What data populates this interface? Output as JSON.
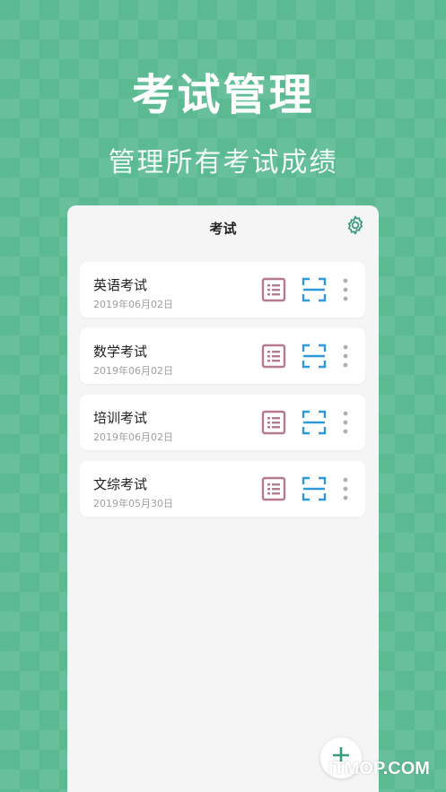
{
  "hero": {
    "title": "考试管理",
    "subtitle": "管理所有考试成绩"
  },
  "app": {
    "title": "考试",
    "settings_icon": "gear-icon",
    "exams": [
      {
        "name": "英语考试",
        "date": "2019年06月02日"
      },
      {
        "name": "数学考试",
        "date": "2019年06月02日"
      },
      {
        "name": "培训考试",
        "date": "2019年06月02日"
      },
      {
        "name": "文综考试",
        "date": "2019年05月30日"
      }
    ],
    "actions": {
      "report_icon": "report-list-icon",
      "scan_icon": "scan-icon",
      "more_icon": "more-vertical-icon"
    },
    "fab_icon": "plus-icon"
  },
  "colors": {
    "background": "#5cba93",
    "accent_green": "#3a9b7a",
    "report_icon": "#b57a8c",
    "scan_icon": "#2e9ad9",
    "more_dots": "#b0b0b0"
  },
  "watermark": "ITMOP.COM"
}
